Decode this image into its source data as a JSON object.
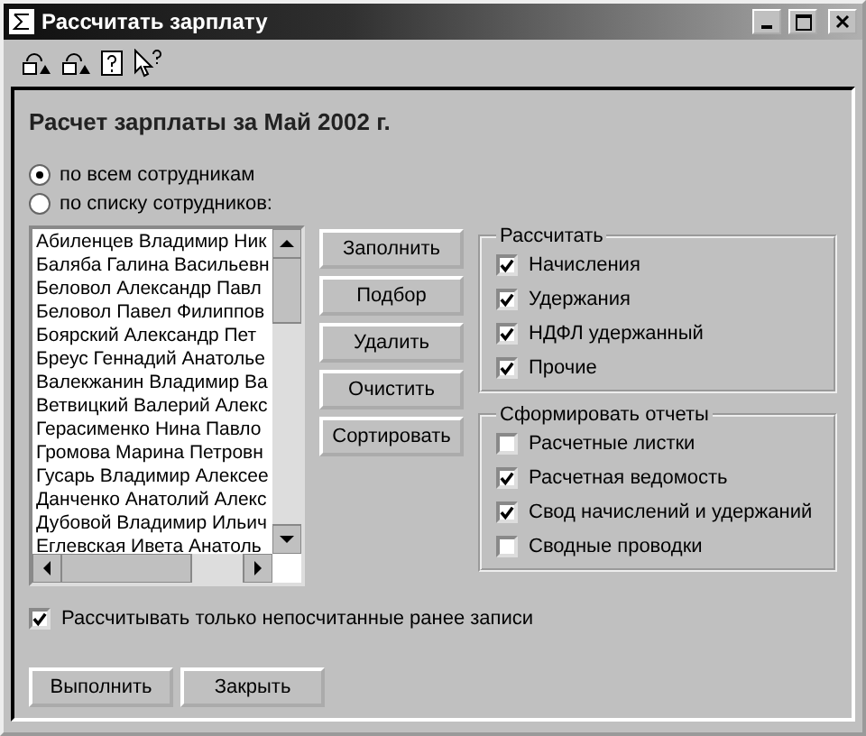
{
  "window": {
    "title": "Рассчитать зарплату"
  },
  "heading": "Расчет зарплаты за Май 2002 г.",
  "scope": [
    {
      "label": "по всем сотрудникам",
      "selected": true
    },
    {
      "label": "по списку сотрудников:",
      "selected": false
    }
  ],
  "employees": [
    "Абиленцев Владимир Ник",
    "Баляба Галина Васильевн",
    "Беловол Александр Павл",
    "Беловол Павел Филиппов",
    "Боярский Александр Пет",
    "Бреус Геннадий Анатолье",
    "Валекжанин Владимир Ва",
    "Ветвицкий Валерий Алекс",
    "Герасименко Нина Павло",
    "Громова Марина Петровн",
    "Гусарь Владимир Алексее",
    "Данченко Анатолий Алекс",
    "Дубовой Владимир Ильич",
    "Еглевская Ивета Анатоль"
  ],
  "list_buttons": [
    "Заполнить",
    "Подбор",
    "Удалить",
    "Очистить",
    "Сортировать"
  ],
  "groups": [
    {
      "title": "Рассчитать",
      "items": [
        {
          "label": "Начисления",
          "checked": true
        },
        {
          "label": "Удержания",
          "checked": true
        },
        {
          "label": "НДФЛ удержанный",
          "checked": true
        },
        {
          "label": "Прочие",
          "checked": true
        }
      ]
    },
    {
      "title": "Сформировать отчеты",
      "items": [
        {
          "label": "Расчетные листки",
          "checked": false
        },
        {
          "label": "Расчетная ведомость",
          "checked": true
        },
        {
          "label": "Свод начислений и удержаний",
          "checked": true
        },
        {
          "label": "Сводные проводки",
          "checked": false
        }
      ]
    }
  ],
  "only_new": {
    "label": "Рассчитывать только непосчитанные ранее записи",
    "checked": true
  },
  "buttons": [
    "Выполнить",
    "Закрыть"
  ]
}
